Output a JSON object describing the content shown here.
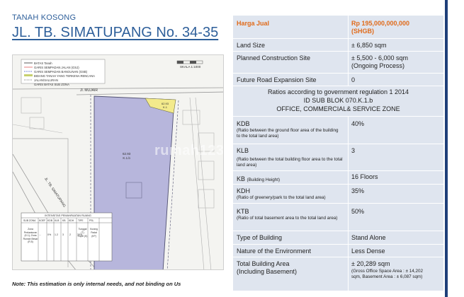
{
  "header": {
    "subtitle": "TANAH KOSONG",
    "title": "JL. TB. SIMATUPANG No. 34-35"
  },
  "map": {
    "legend_lines": [
      "BATAS Tanah",
      "GARIS SEMPADAN JALAN (GSJ)",
      "GARIS SEMPADAN BANGUNAN (GSB)",
      "BIDANG TANAH YANG TERKENA RENCANA JALAN/SALURAN",
      "GARIS BATAS SUB ZONA"
    ],
    "scale_label": "SKALA 1:1000",
    "street_top": "Jl. MUJAIR",
    "street_left": "JL. TB. SIMATUPANG",
    "parcel_main": "62.93",
    "parcel_main_sub": "K.1.b",
    "parcel_small": "62.93",
    "parcel_small_sub": "K.1",
    "watermark": "rumah123",
    "zoning_table_title": "INTENSITAS PEMANFAATAN RUANG",
    "zoning_headers": [
      "SUB ZONA",
      "KOEF",
      "KDB",
      "KLB",
      "KB",
      "KDH",
      "TIPE",
      "PSL"
    ],
    "zoning_row": [
      "Zona Perkantoran (K.1); Zona Rumah Besar (R.5)",
      "...",
      "0%",
      "1.2",
      "3",
      "2",
      "30%",
      "Tunggal (T)",
      "Kopel (K)",
      "Kurang Padat (KP)"
    ]
  },
  "note": "Note: This estimation is only internal needs, and not binding on Us",
  "table": {
    "price_label": "Harga Jual",
    "price_value": "Rp 195,000,000,000",
    "price_sub": "(SHGB)",
    "land_size_label": "Land Size",
    "land_size_value": "± 6,850 sqm",
    "planned_label": "Planned Construction Site",
    "planned_value": "± 5,500 - 6,000 sqm",
    "planned_sub": "(Ongoing Process)",
    "road_label": "Future Road Expansion Site",
    "road_value": "0",
    "ratios_line1": "Ratios according to government regulation 1 2014",
    "ratios_line2": "ID SUB BLOK 070.K.1.b",
    "ratios_line3": "OFFICE, COMMERCIAL& SERVICE ZONE",
    "kdb_label": "KDB",
    "kdb_desc": "(Ratio between the ground floor area of the building to the total land area)",
    "kdb_value": "40%",
    "klb_label": "KLB",
    "klb_desc": "(Ratio between the total building floor area to the total land area)",
    "klb_value": "3",
    "kb_label": "KB",
    "kb_desc": "(Building Height)",
    "kb_value": "16 Floors",
    "kdh_label": "KDH",
    "kdh_desc": "(Ratio of greenery/park to the total land area)",
    "kdh_value": "35%",
    "ktb_label": "KTB",
    "ktb_desc": "(Ratio of total basement area to the total land area)",
    "ktb_value": "50%",
    "type_label": "Type of Building",
    "type_value": "Stand Alone",
    "nature_label": "Nature of the Environment",
    "nature_value": "Less Dense",
    "total_label_1": "Total Building Area",
    "total_label_2": "(Including Basement)",
    "total_value": "± 20,289 sqm",
    "total_sub_1": "(Gross Office Space Area : ± 14,202",
    "total_sub_2": "sqm, Basement Area : ± 6,087 sqm)"
  },
  "colors": {
    "title_blue": "#2e5f9a",
    "price_orange": "#e06b1b",
    "panel_bg": "#dfe5ef",
    "edge_navy": "#1f3f79",
    "parcel_fill": "#b7b6dc",
    "parcel_yellow": "#f3ea8c"
  }
}
